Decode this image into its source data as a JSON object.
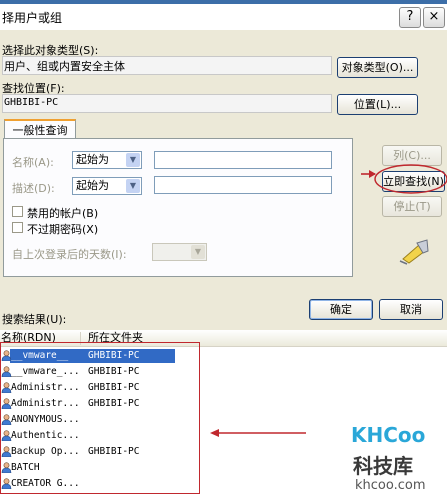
{
  "window": {
    "title": "择用户或组",
    "help_label": "?",
    "close_label": "×"
  },
  "object_type": {
    "label": "选择此对象类型(S):",
    "value": "用户、组或内置安全主体",
    "button": "对象类型(O)..."
  },
  "location": {
    "label": "查找位置(F):",
    "value": "GHBIBI-PC",
    "button": "位置(L)..."
  },
  "tab": {
    "label": "一般性查询"
  },
  "query": {
    "name_label": "名称(A):",
    "name_mode": "起始为",
    "desc_label": "描述(D):",
    "desc_mode": "起始为",
    "disabled_accounts": "禁用的帐户(B)",
    "no_expire_pwd": "不过期密码(X)",
    "days_since_login": "自上次登录后的天数(I):"
  },
  "side_buttons": {
    "columns": "列(C)...",
    "find_now": "立即查找(N)",
    "stop": "停止(T)"
  },
  "dialog_buttons": {
    "ok": "确定",
    "cancel": "取消"
  },
  "results": {
    "label": "搜索结果(U):",
    "col_name": "名称(RDN)",
    "col_folder": "所在文件夹",
    "rows": [
      {
        "name": "__vmware__",
        "folder": "GHBIBI-PC",
        "selected": true
      },
      {
        "name": "__vmware_...",
        "folder": "GHBIBI-PC",
        "selected": false
      },
      {
        "name": "Administr...",
        "folder": "GHBIBI-PC",
        "selected": false
      },
      {
        "name": "Administr...",
        "folder": "GHBIBI-PC",
        "selected": false
      },
      {
        "name": "ANONYMOUS...",
        "folder": "",
        "selected": false
      },
      {
        "name": "Authentic...",
        "folder": "",
        "selected": false
      },
      {
        "name": "Backup Op...",
        "folder": "GHBIBI-PC",
        "selected": false
      },
      {
        "name": "BATCH",
        "folder": "",
        "selected": false
      },
      {
        "name": "CREATOR G...",
        "folder": "",
        "selected": false
      }
    ]
  },
  "watermark": {
    "brand": "KHCoo",
    "cn": "科技库",
    "url": "khcoo.com"
  },
  "colors": {
    "annotation_red": "#c0282e",
    "selection_blue": "#316ac5",
    "brand_blue": "#2aa7d8"
  }
}
